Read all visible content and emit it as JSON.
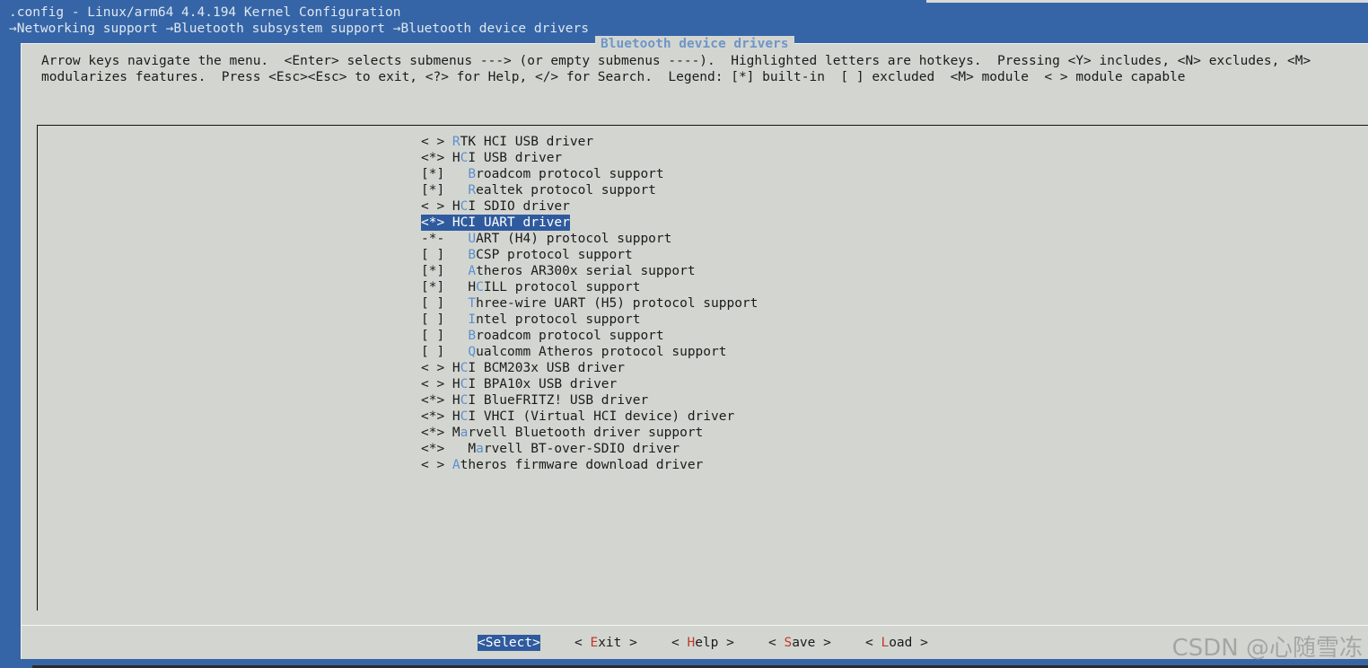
{
  "window": {
    "title": ".config - Linux/arm64 4.4.194 Kernel Configuration",
    "breadcrumb": "→Networking support →Bluetooth subsystem support →Bluetooth device drivers"
  },
  "dialog": {
    "title": "Bluetooth device drivers",
    "help_line_1": "Arrow keys navigate the menu.  <Enter> selects submenus ---> (or empty submenus ----).  Highlighted letters are hotkeys.  Pressing <Y> includes, <N> excludes, <M>",
    "help_line_2": "modularizes features.  Press <Esc><Esc> to exit, <?> for Help, </> for Search.  Legend: [*] built-in  [ ] excluded  <M> module  < > module capable"
  },
  "menu": {
    "items": [
      {
        "prefix": "< > ",
        "hotkey": "R",
        "rest": "TK HCI USB driver"
      },
      {
        "prefix": "<*> H",
        "hotkey": "C",
        "rest": "I USB driver"
      },
      {
        "prefix": "[*]   ",
        "hotkey": "B",
        "rest": "roadcom protocol support"
      },
      {
        "prefix": "[*]   ",
        "hotkey": "R",
        "rest": "ealtek protocol support"
      },
      {
        "prefix": "< > H",
        "hotkey": "C",
        "rest": "I SDIO driver"
      },
      {
        "prefix": "<*> ",
        "hotkey": "H",
        "rest": "CI UART driver"
      },
      {
        "prefix": "-*-   ",
        "hotkey": "U",
        "rest": "ART (H4) protocol support"
      },
      {
        "prefix": "[ ]   ",
        "hotkey": "B",
        "rest": "CSP protocol support"
      },
      {
        "prefix": "[*]   ",
        "hotkey": "A",
        "rest": "theros AR300x serial support"
      },
      {
        "prefix": "[*]   H",
        "hotkey": "C",
        "rest": "ILL protocol support"
      },
      {
        "prefix": "[ ]   ",
        "hotkey": "T",
        "rest": "hree-wire UART (H5) protocol support"
      },
      {
        "prefix": "[ ]   ",
        "hotkey": "I",
        "rest": "ntel protocol support"
      },
      {
        "prefix": "[ ]   ",
        "hotkey": "B",
        "rest": "roadcom protocol support"
      },
      {
        "prefix": "[ ]   ",
        "hotkey": "Q",
        "rest": "ualcomm Atheros protocol support"
      },
      {
        "prefix": "< > H",
        "hotkey": "C",
        "rest": "I BCM203x USB driver"
      },
      {
        "prefix": "< > H",
        "hotkey": "C",
        "rest": "I BPA10x USB driver"
      },
      {
        "prefix": "<*> H",
        "hotkey": "C",
        "rest": "I BlueFRITZ! USB driver"
      },
      {
        "prefix": "<*> H",
        "hotkey": "C",
        "rest": "I VHCI (Virtual HCI device) driver"
      },
      {
        "prefix": "<*> M",
        "hotkey": "a",
        "rest": "rvell Bluetooth driver support"
      },
      {
        "prefix": "<*>   M",
        "hotkey": "a",
        "rest": "rvell BT-over-SDIO driver"
      },
      {
        "prefix": "< > ",
        "hotkey": "A",
        "rest": "theros firmware download driver"
      }
    ],
    "selected_index": 5
  },
  "buttons": [
    {
      "pre": "<",
      "hotkey": "S",
      "rest": "elect>"
    },
    {
      "pre": "< ",
      "hotkey": "E",
      "rest": "xit >"
    },
    {
      "pre": "< ",
      "hotkey": "H",
      "rest": "elp >"
    },
    {
      "pre": "< ",
      "hotkey": "S",
      "rest": "ave >"
    },
    {
      "pre": "< ",
      "hotkey": "L",
      "rest": "oad >"
    }
  ],
  "watermark": "CSDN @心随雪冻",
  "colors": {
    "background": "#3565a6",
    "dialog": "#d3d6d0",
    "highlight": "#2f5b9e",
    "menu_hotkey": "#5b8fd0",
    "button_hotkey": "#c0392b"
  }
}
